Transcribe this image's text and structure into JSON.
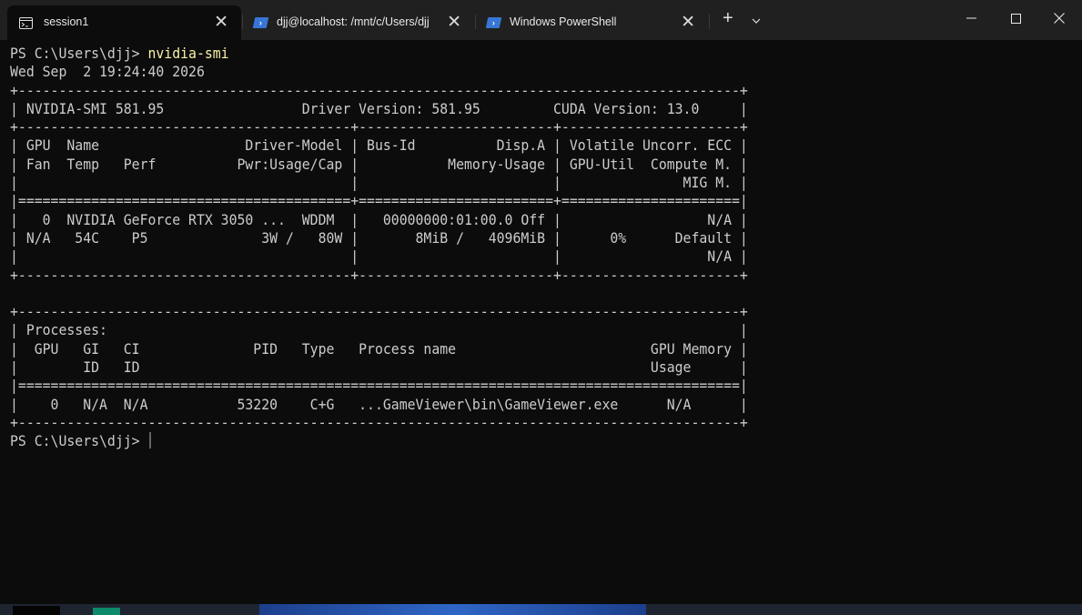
{
  "tabs": [
    {
      "label": "session1",
      "icon": "terminal-icon",
      "active": true
    },
    {
      "label": "djj@localhost: /mnt/c/Users/djj",
      "icon": "powershell-icon",
      "active": false
    },
    {
      "label": "Windows PowerShell",
      "icon": "powershell-icon",
      "active": false
    }
  ],
  "tab_close_glyph": "✕",
  "new_tab_glyph": "+",
  "window_controls": {
    "minimize": "─",
    "maximize": "☐",
    "close": "✕"
  },
  "terminal": {
    "prompt1": "PS C:\\Users\\djj> ",
    "command": "nvidia-smi",
    "output": [
      "Wed Sep  2 19:24:40 2026",
      "+-----------------------------------------------------------------------------------------+",
      "| NVIDIA-SMI 581.95                 Driver Version: 581.95         CUDA Version: 13.0     |",
      "+-----------------------------------------+------------------------+----------------------+",
      "| GPU  Name                  Driver-Model | Bus-Id          Disp.A | Volatile Uncorr. ECC |",
      "| Fan  Temp   Perf          Pwr:Usage/Cap |           Memory-Usage | GPU-Util  Compute M. |",
      "|                                         |                        |               MIG M. |",
      "|=========================================+========================+======================|",
      "|   0  NVIDIA GeForce RTX 3050 ...  WDDM  |   00000000:01:00.0 Off |                  N/A |",
      "| N/A   54C    P5              3W /   80W |       8MiB /   4096MiB |      0%      Default |",
      "|                                         |                        |                  N/A |",
      "+-----------------------------------------+------------------------+----------------------+",
      "",
      "+-----------------------------------------------------------------------------------------+",
      "| Processes:                                                                              |",
      "|  GPU   GI   CI              PID   Type   Process name                        GPU Memory |",
      "|        ID   ID                                                               Usage      |",
      "|=========================================================================================|",
      "|    0   N/A  N/A           53220    C+G   ...GameViewer\\bin\\GameViewer.exe      N/A      |",
      "+-----------------------------------------------------------------------------------------+"
    ],
    "prompt2": "PS C:\\Users\\djj> "
  },
  "colors": {
    "background": "#0c0c0c",
    "text": "#cccccc",
    "command": "#f9f1a5",
    "tabbar": "#202020",
    "ps_blue": "#3776d6"
  }
}
